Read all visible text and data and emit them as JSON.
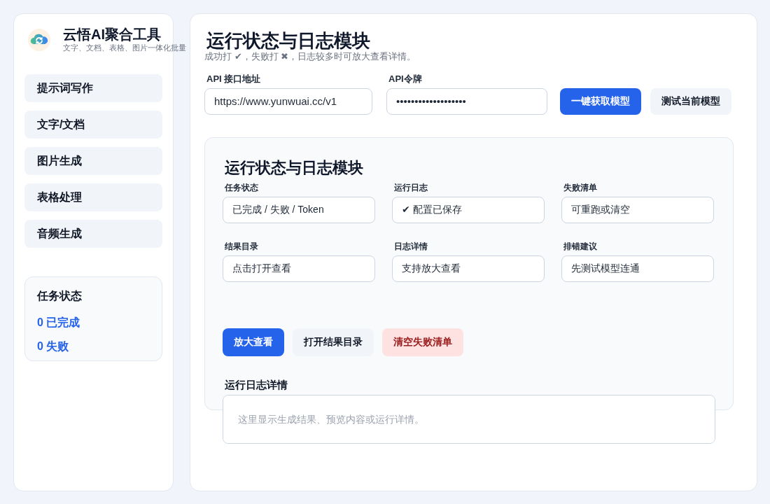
{
  "sidebar": {
    "brand": {
      "title": "云悟AI聚合工具",
      "subtitle": "文字、文档、表格、图片一体化批量"
    },
    "items": [
      {
        "label": "提示词写作",
        "selected": false
      },
      {
        "label": "文字/文档",
        "selected": false
      },
      {
        "label": "图片生成",
        "selected": false
      },
      {
        "label": "表格处理",
        "selected": false
      },
      {
        "label": "音频生成",
        "selected": false
      }
    ],
    "status_card": {
      "title": "任务状态",
      "lines": [
        "0 已完成",
        "0 失败"
      ]
    }
  },
  "main": {
    "title": "运行状态与日志模块",
    "subtitle": "成功打 ✔，失败打 ✖，日志较多时可放大查看详情。",
    "api_fields": [
      {
        "label": "API 接口地址",
        "value": "https://www.yunwuai.cc/v1"
      },
      {
        "label": "API令牌",
        "value": "•••••••••••••••••••"
      }
    ],
    "buttons": [
      {
        "label": "一键获取模型",
        "kind": "primary"
      },
      {
        "label": "测试当前模型",
        "kind": "secondary"
      }
    ],
    "panel": {
      "title": "运行状态与日志模块",
      "fields": [
        {
          "label": "任务状态",
          "value": "已完成 / 失败 / Token"
        },
        {
          "label": "运行日志",
          "value": "✔ 配置已保存"
        },
        {
          "label": "失败清单",
          "value": "可重跑或清空"
        },
        {
          "label": "结果目录",
          "value": "点击打开查看"
        },
        {
          "label": "日志详情",
          "value": "支持放大查看"
        },
        {
          "label": "排错建议",
          "value": "先测试模型连通"
        }
      ],
      "buttons": [
        {
          "label": "放大查看",
          "kind": "primary"
        },
        {
          "label": "打开结果目录",
          "kind": "secondary"
        },
        {
          "label": "清空失败清单",
          "kind": "danger"
        }
      ],
      "log": {
        "label": "运行日志详情",
        "placeholder": "这里显示生成结果、预览内容或运行详情。"
      }
    }
  }
}
